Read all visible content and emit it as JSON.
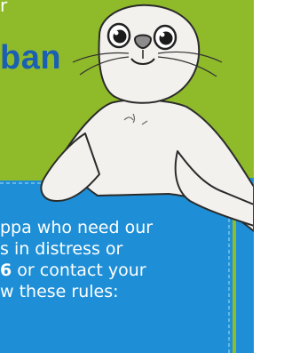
{
  "top_fragment": "r",
  "heading_fragment": "ban",
  "panel": {
    "line1": "ppa who need our",
    "line2": "s in distress or",
    "line3_bold": "6",
    "line3_rest": " or contact your",
    "line4": "w these rules:"
  },
  "colors": {
    "background_green": "#8fba2a",
    "panel_blue": "#1e8fd6",
    "heading_blue": "#1a5fb4",
    "text_white": "#ffffff"
  },
  "illustration": "cartoon-seal"
}
